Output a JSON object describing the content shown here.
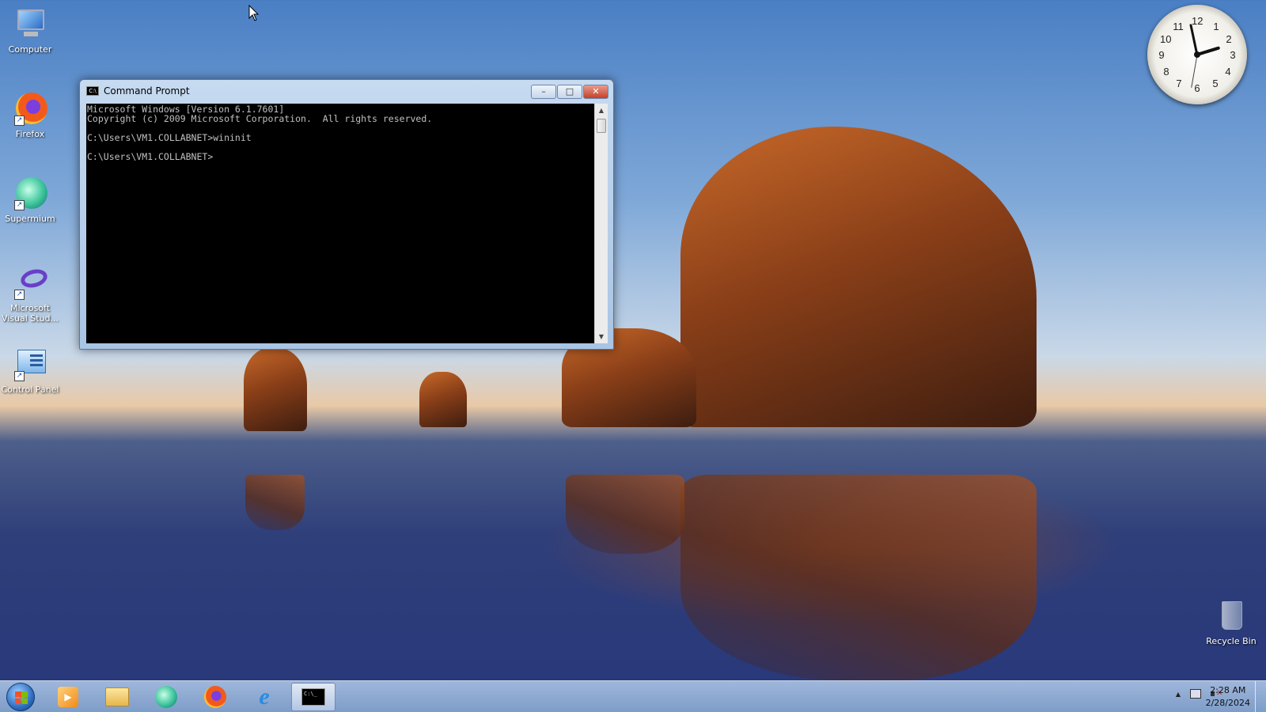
{
  "desktop": {
    "icons": [
      {
        "label": "Computer",
        "icon": "computer-icon"
      },
      {
        "label": "Firefox",
        "icon": "firefox-icon"
      },
      {
        "label": "Supermium",
        "icon": "supermium-icon"
      },
      {
        "label": "Microsoft Visual Stud...",
        "icon": "visual-studio-icon"
      },
      {
        "label": "Control Panel",
        "icon": "control-panel-icon"
      }
    ],
    "recycle_bin": {
      "label": "Recycle Bin",
      "icon": "recycle-bin-icon"
    }
  },
  "window": {
    "title": "Command Prompt",
    "buttons": {
      "minimize": "–",
      "maximize": "□",
      "close": "✕"
    },
    "console_lines": [
      "Microsoft Windows [Version 6.1.7601]",
      "Copyright (c) 2009 Microsoft Corporation.  All rights reserved.",
      "",
      "C:\\Users\\VM1.COLLABNET>wininit",
      "",
      "C:\\Users\\VM1.COLLABNET>"
    ]
  },
  "clock_gadget": {
    "numbers": [
      "12",
      "1",
      "2",
      "3",
      "4",
      "5",
      "6",
      "7",
      "8",
      "9",
      "10",
      "11"
    ]
  },
  "taskbar": {
    "apps": [
      {
        "name": "media-player",
        "icon": "media-player-icon"
      },
      {
        "name": "explorer",
        "icon": "folder-icon"
      },
      {
        "name": "supermium",
        "icon": "supermium-icon"
      },
      {
        "name": "firefox",
        "icon": "firefox-icon"
      },
      {
        "name": "internet-explorer",
        "icon": "internet-explorer-icon"
      },
      {
        "name": "command-prompt",
        "icon": "cmd-icon"
      }
    ],
    "tray": {
      "show_hidden": "▲"
    },
    "time": "2:28 AM",
    "date": "2/28/2024"
  }
}
